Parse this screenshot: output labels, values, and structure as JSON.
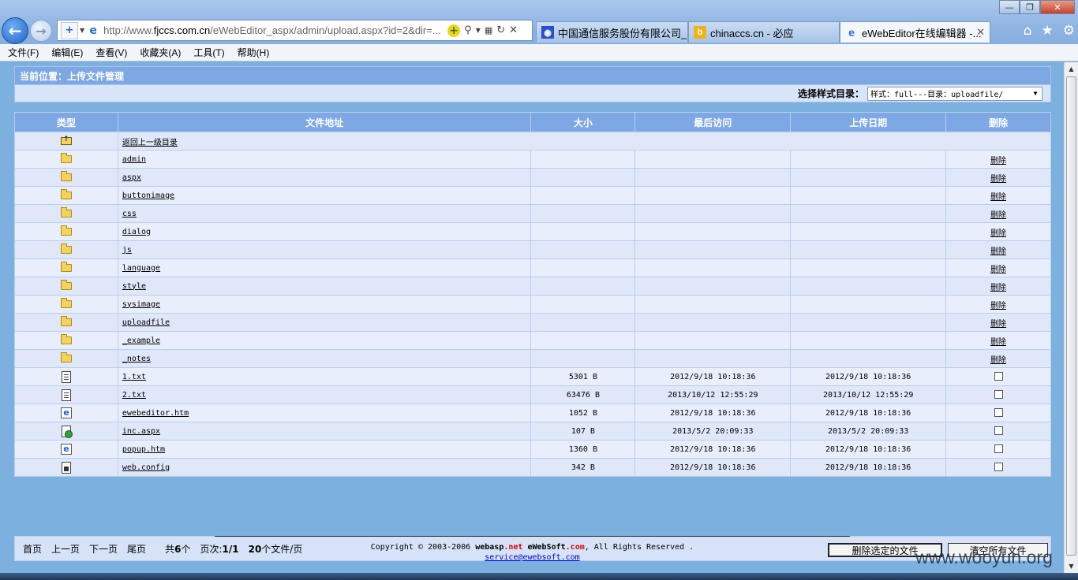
{
  "browser": {
    "address": {
      "url_prefix": "http://www.",
      "url_domain": "fjccs.com.cn",
      "url_rest": "/eWebEditor_aspx/admin/upload.aspx?id=2&dir=..."
    },
    "tabs": [
      {
        "label": "中国通信服务股份有限公司_..."
      },
      {
        "label": "chinaccs.cn - 必应"
      },
      {
        "label": "eWebEditor在线编辑器 -..."
      }
    ],
    "menu": [
      "文件(F)",
      "编辑(E)",
      "查看(V)",
      "收藏夹(A)",
      "工具(T)",
      "帮助(H)"
    ]
  },
  "page": {
    "location": "当前位置：上传文件管理",
    "style_label": "选择样式目录：",
    "style_value": "样式：full---目录：uploadfile/",
    "headers": {
      "type": "类型",
      "path": "文件地址",
      "size": "大小",
      "last_access": "最后访问",
      "upload_date": "上传日期",
      "delete": "删除"
    },
    "up_dir": "返回上一级目录",
    "delete_label": "删除",
    "folders": [
      "admin",
      "aspx",
      "buttonimage",
      "css",
      "dialog",
      "js",
      "language",
      "style",
      "sysimage",
      "uploadfile",
      "_example",
      "_notes"
    ],
    "files": [
      {
        "name": "1.txt",
        "size": "5301 B",
        "access": "2012/9/18 10:18:36",
        "upload": "2012/9/18 10:18:36",
        "icon": "text-file-icon"
      },
      {
        "name": "2.txt",
        "size": "63476 B",
        "access": "2013/10/12 12:55:29",
        "upload": "2013/10/12 12:55:29",
        "icon": "text-file-icon"
      },
      {
        "name": "ewebeditor.htm",
        "size": "1052 B",
        "access": "2012/9/18 10:18:36",
        "upload": "2012/9/18 10:18:36",
        "icon": "html-file-icon"
      },
      {
        "name": "inc.aspx",
        "size": "107 B",
        "access": "2013/5/2 20:09:33",
        "upload": "2013/5/2 20:09:33",
        "icon": "aspx-file-icon"
      },
      {
        "name": "popup.htm",
        "size": "1360 B",
        "access": "2012/9/18 10:18:36",
        "upload": "2012/9/18 10:18:36",
        "icon": "html-file-icon"
      },
      {
        "name": "web.config",
        "size": "342 B",
        "access": "2012/9/18 10:18:36",
        "upload": "2012/9/18 10:18:36",
        "icon": "config-file-icon"
      }
    ],
    "pager": {
      "first": "首页",
      "prev": "上一页",
      "next": "下一页",
      "last": "尾页",
      "total_prefix": "共",
      "total": "6",
      "total_suffix": "个",
      "page_prefix": "页次:",
      "page": "1/1",
      "per_page": "20",
      "per_page_suffix": "个文件/页"
    },
    "buttons": {
      "delete_selected": "删除选定的文件",
      "clear_all": "清空所有文件"
    },
    "copyright": {
      "prefix": "Copyright © 2003-2006 ",
      "brand1": "webasp",
      "dot1": ".",
      "brand1_tld": "net",
      "brand2": "eWebSoft",
      "dot2": ".",
      "brand2_tld": "com",
      "suffix": ", All Rights Reserved ."
    },
    "email": "service@ewebsoft.com"
  },
  "watermark": "www.wooyun.org"
}
